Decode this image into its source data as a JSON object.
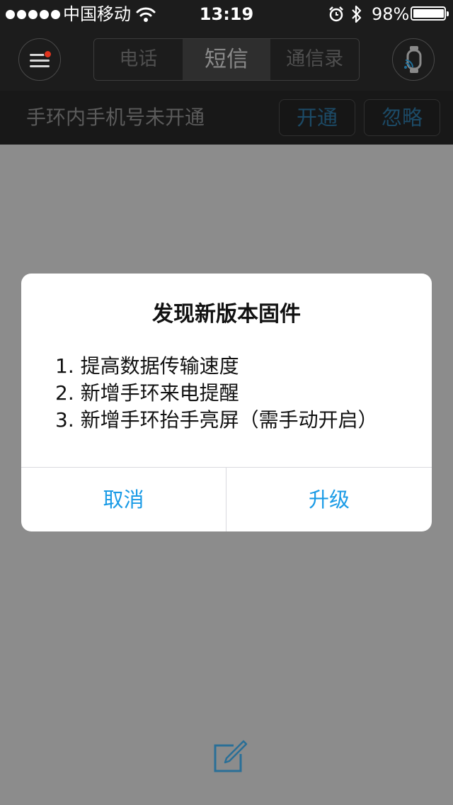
{
  "status_bar": {
    "carrier": "中国移动",
    "time": "13:19",
    "battery_percent": "98%",
    "battery_level": 0.98,
    "icons": [
      "signal-dots-icon",
      "wifi-icon",
      "alarm-icon",
      "bluetooth-icon",
      "battery-icon"
    ]
  },
  "nav": {
    "tabs": [
      {
        "label": "电话",
        "active": false
      },
      {
        "label": "短信",
        "active": true
      },
      {
        "label": "通信录",
        "active": false
      }
    ],
    "icons": [
      "menu-icon",
      "band-sync-icon"
    ]
  },
  "notice": {
    "text": "手环内手机号未开通",
    "open_label": "开通",
    "ignore_label": "忽略"
  },
  "dialog": {
    "title": "发现新版本固件",
    "lines": [
      "1. 提高数据传输速度",
      "2. 新增手环来电提醒",
      "3. 新增手环抬手亮屏（需手动开启）"
    ],
    "cancel_label": "取消",
    "confirm_label": "升级"
  },
  "colors": {
    "accent": "#1a9be6",
    "overlay": "#8c8c8c",
    "badge": "#e0341e"
  },
  "compose_icon": "compose-icon"
}
